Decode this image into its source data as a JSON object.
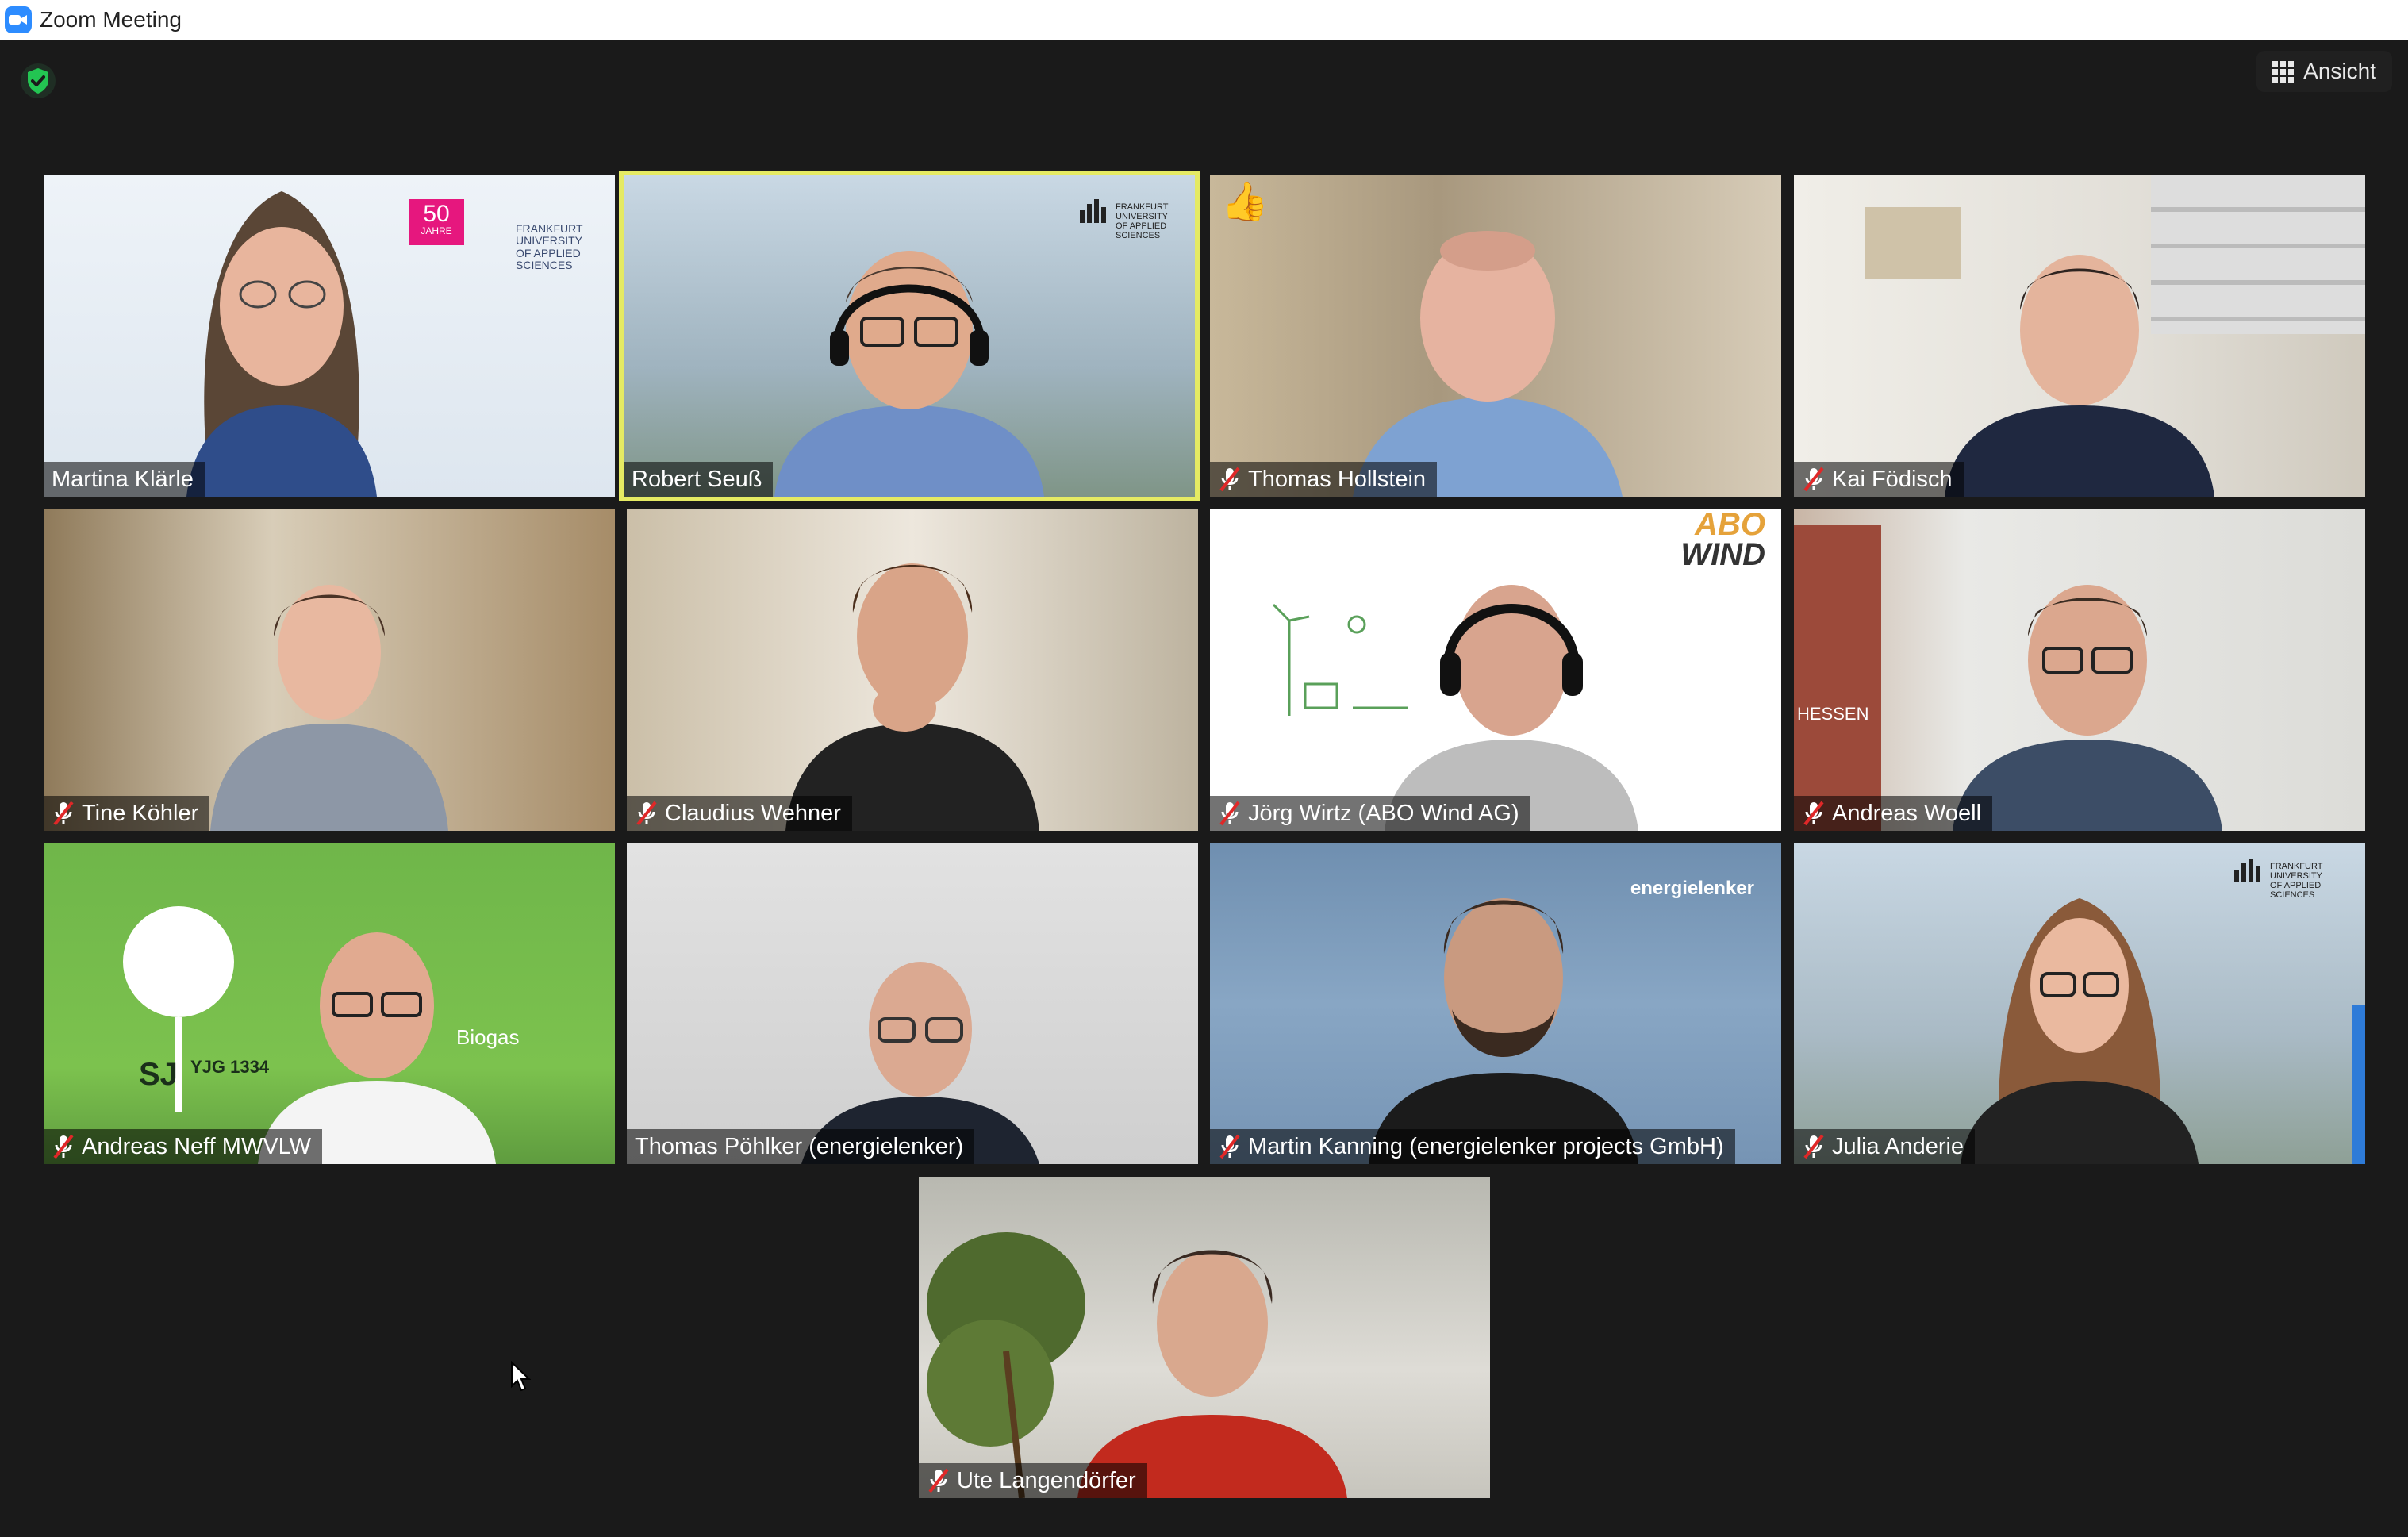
{
  "window": {
    "title": "Zoom Meeting"
  },
  "toolbar": {
    "view_label": "Ansicht"
  },
  "participants": [
    {
      "name": "Martina Klärle",
      "muted": false
    },
    {
      "name": "Robert Seuß",
      "muted": false,
      "active_speaker": true
    },
    {
      "name": "Thomas Hollstein",
      "muted": true,
      "reaction": "👍"
    },
    {
      "name": "Kai Födisch",
      "muted": true
    },
    {
      "name": "Tine Köhler",
      "muted": true
    },
    {
      "name": "Claudius Wehner",
      "muted": true
    },
    {
      "name": "Jörg Wirtz (ABO Wind AG)",
      "muted": true
    },
    {
      "name": "Andreas Woell",
      "muted": true
    },
    {
      "name": "Andreas Neff MWVLW",
      "muted": true
    },
    {
      "name": "Thomas Pöhlker (energielenker)",
      "muted": false
    },
    {
      "name": "Martin Kanning (energielenker projects GmbH)",
      "muted": true
    },
    {
      "name": "Julia Anderie",
      "muted": true
    },
    {
      "name": "Ute Langendörfer",
      "muted": true
    }
  ],
  "backgrounds": {
    "logo_50": "50",
    "logo_jahre": "JAHRE",
    "fra_uas_1": "FRANKFURT",
    "fra_uas_2": "UNIVERSITY",
    "fra_uas_3": "OF APPLIED SCIENCES",
    "abo": "ABO",
    "wind": "WIND",
    "energielenker": "energielenker",
    "hessen": "HESSEN",
    "sj": "SJ",
    "yjg": "YJG 1334",
    "biogas": "Biogas"
  },
  "colors": {
    "speaker_border": "#e5ea63",
    "muted_icon": "#e02828",
    "shield": "#23c552",
    "zoom_blue": "#2d8cff"
  }
}
